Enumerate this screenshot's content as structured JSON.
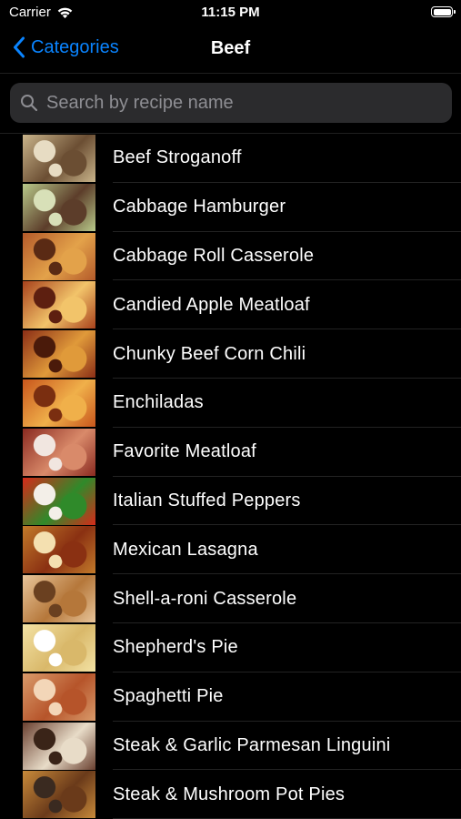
{
  "status_bar": {
    "carrier": "Carrier",
    "time": "11:15 PM"
  },
  "nav": {
    "back_label": "Categories",
    "title": "Beef"
  },
  "search": {
    "placeholder": "Search by recipe name"
  },
  "colors": {
    "accent": "#0a84ff",
    "background": "#000000",
    "search_bg": "#2b2b2d"
  },
  "recipes": [
    {
      "name": "Beef Stroganoff",
      "thumb_colors": [
        "#c9b48a",
        "#6b4e33",
        "#e7dcc3"
      ]
    },
    {
      "name": "Cabbage Hamburger",
      "thumb_colors": [
        "#b8c98a",
        "#5c3d2a",
        "#d8e0b8"
      ]
    },
    {
      "name": "Cabbage Roll Casserole",
      "thumb_colors": [
        "#b45a2a",
        "#e3a24a",
        "#5a2a14"
      ]
    },
    {
      "name": "Candied Apple Meatloaf",
      "thumb_colors": [
        "#a8421c",
        "#f2c46a",
        "#5d1f10"
      ]
    },
    {
      "name": "Chunky Beef Corn Chili",
      "thumb_colors": [
        "#8b2e16",
        "#e09a3a",
        "#4a1a0a"
      ]
    },
    {
      "name": "Enchiladas",
      "thumb_colors": [
        "#c8561c",
        "#f0b04a",
        "#7a2e10"
      ]
    },
    {
      "name": "Favorite Meatloaf",
      "thumb_colors": [
        "#8a2a20",
        "#d98a6a",
        "#f1e6e0"
      ]
    },
    {
      "name": "Italian Stuffed Peppers",
      "thumb_colors": [
        "#d62a1a",
        "#2f8a2a",
        "#f3efe8"
      ]
    },
    {
      "name": "Mexican Lasagna",
      "thumb_colors": [
        "#c27a2a",
        "#8a3012",
        "#f4e0b0"
      ]
    },
    {
      "name": "Shell-a-roni Casserole",
      "thumb_colors": [
        "#e8c59a",
        "#b5773a",
        "#6a4020"
      ]
    },
    {
      "name": "Shepherd's Pie",
      "thumb_colors": [
        "#f3e2a4",
        "#d9b86a",
        "#ffffff"
      ]
    },
    {
      "name": "Spaghetti Pie",
      "thumb_colors": [
        "#d99a6a",
        "#b6542a",
        "#f3d6b8"
      ]
    },
    {
      "name": "Steak & Garlic Parmesan Linguini",
      "thumb_colors": [
        "#6a4030",
        "#e8dcc8",
        "#3a2418"
      ]
    },
    {
      "name": "Steak & Mushroom Pot Pies",
      "thumb_colors": [
        "#c88a3a",
        "#6a3a1a",
        "#3a2a20"
      ]
    }
  ]
}
